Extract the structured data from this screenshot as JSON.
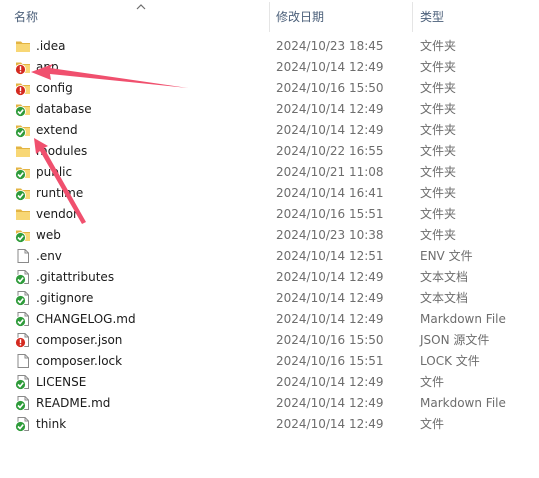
{
  "header": {
    "name_label": "名称",
    "date_label": "修改日期",
    "type_label": "类型",
    "sort_icon": "chevron-up-icon"
  },
  "files": [
    {
      "name": ".idea",
      "date": "2024/10/23 18:45",
      "type": "文件夹",
      "icon": "folder",
      "badge": null
    },
    {
      "name": "app",
      "date": "2024/10/14 12:49",
      "type": "文件夹",
      "icon": "folder",
      "badge": "conflict"
    },
    {
      "name": "config",
      "date": "2024/10/16 15:50",
      "type": "文件夹",
      "icon": "folder",
      "badge": "conflict"
    },
    {
      "name": "database",
      "date": "2024/10/14 12:49",
      "type": "文件夹",
      "icon": "folder",
      "badge": "ok"
    },
    {
      "name": "extend",
      "date": "2024/10/14 12:49",
      "type": "文件夹",
      "icon": "folder",
      "badge": "ok"
    },
    {
      "name": "modules",
      "date": "2024/10/22 16:55",
      "type": "文件夹",
      "icon": "folder",
      "badge": null
    },
    {
      "name": "public",
      "date": "2024/10/21 11:08",
      "type": "文件夹",
      "icon": "folder",
      "badge": "ok"
    },
    {
      "name": "runtime",
      "date": "2024/10/14 16:41",
      "type": "文件夹",
      "icon": "folder",
      "badge": "ok"
    },
    {
      "name": "vendor",
      "date": "2024/10/16 15:51",
      "type": "文件夹",
      "icon": "folder",
      "badge": null
    },
    {
      "name": "web",
      "date": "2024/10/23 10:38",
      "type": "文件夹",
      "icon": "folder",
      "badge": "ok"
    },
    {
      "name": ".env",
      "date": "2024/10/14 12:51",
      "type": "ENV 文件",
      "icon": "file",
      "badge": null
    },
    {
      "name": ".gitattributes",
      "date": "2024/10/14 12:49",
      "type": "文本文档",
      "icon": "file",
      "badge": "ok"
    },
    {
      "name": ".gitignore",
      "date": "2024/10/14 12:49",
      "type": "文本文档",
      "icon": "file",
      "badge": "ok"
    },
    {
      "name": "CHANGELOG.md",
      "date": "2024/10/14 12:49",
      "type": "Markdown File",
      "icon": "file",
      "badge": "ok"
    },
    {
      "name": "composer.json",
      "date": "2024/10/16 15:50",
      "type": "JSON 源文件",
      "icon": "file",
      "badge": "conflict"
    },
    {
      "name": "composer.lock",
      "date": "2024/10/16 15:51",
      "type": "LOCK 文件",
      "icon": "file",
      "badge": null
    },
    {
      "name": "LICENSE",
      "date": "2024/10/14 12:49",
      "type": "文件",
      "icon": "file",
      "badge": "ok"
    },
    {
      "name": "README.md",
      "date": "2024/10/14 12:49",
      "type": "Markdown File",
      "icon": "file",
      "badge": "ok"
    },
    {
      "name": "think",
      "date": "2024/10/14 12:49",
      "type": "文件",
      "icon": "file",
      "badge": "ok"
    }
  ],
  "colors": {
    "folder": "#f8d775",
    "folder_dark": "#e3b443",
    "badge_ok": "#2e9b3a",
    "badge_conflict": "#d42a20",
    "annotation_arrow": "#f0506e"
  }
}
